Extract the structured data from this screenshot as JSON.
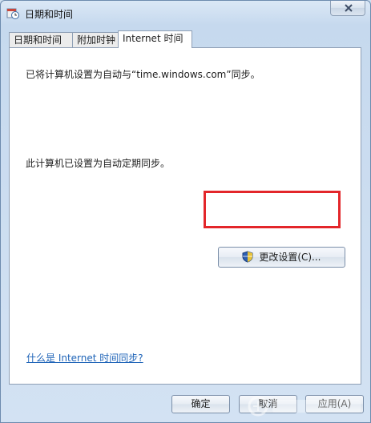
{
  "window": {
    "title": "日期和时间"
  },
  "tabs": [
    {
      "label": "日期和时间"
    },
    {
      "label": "附加时钟"
    },
    {
      "label": "Internet 时间"
    }
  ],
  "panel": {
    "sync_message": "已将计算机设置为自动与“time.windows.com”同步。",
    "status_message": "此计算机已设置为自动定期同步。",
    "change_settings_label": "更改设置(C)...",
    "help_link": "什么是 Internet 时间同步?"
  },
  "footer": {
    "ok_label": "确定",
    "cancel_label": "取消",
    "apply_label": "应用(A)"
  },
  "colors": {
    "highlight": "#e3262a",
    "link": "#1f64b8"
  }
}
